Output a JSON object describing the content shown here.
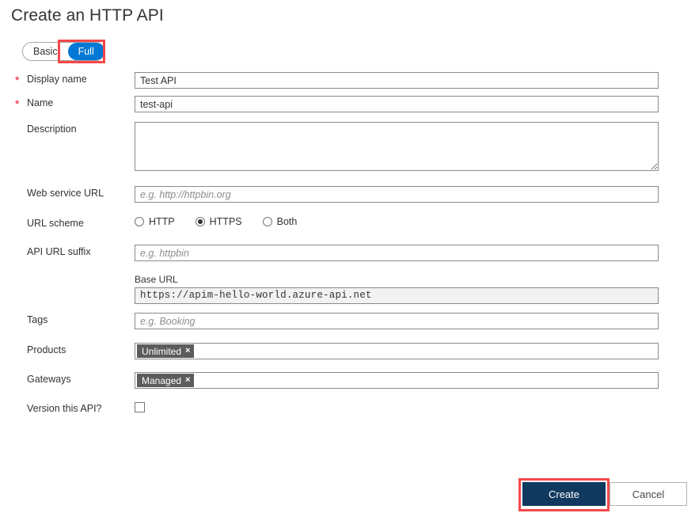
{
  "page": {
    "title": "Create an HTTP API"
  },
  "mode_toggle": {
    "options": [
      {
        "label": "Basic",
        "selected": false
      },
      {
        "label": "Full",
        "selected": true
      }
    ],
    "selected": "Full",
    "accent_color": "#0078d4"
  },
  "annotations": {
    "color": "#f5474a",
    "boxes": [
      "full-toggle",
      "create-button"
    ]
  },
  "form": {
    "required_marker": "*",
    "fields": {
      "display_name": {
        "label": "Display name",
        "required": true,
        "value": "Test API",
        "placeholder": ""
      },
      "name": {
        "label": "Name",
        "required": true,
        "value": "test-api",
        "placeholder": ""
      },
      "description": {
        "label": "Description",
        "required": false,
        "value": "",
        "placeholder": ""
      },
      "web_service_url": {
        "label": "Web service URL",
        "required": false,
        "value": "",
        "placeholder": "e.g. http://httpbin.org"
      },
      "url_scheme": {
        "label": "URL scheme",
        "options": [
          {
            "label": "HTTP",
            "checked": false
          },
          {
            "label": "HTTPS",
            "checked": true
          },
          {
            "label": "Both",
            "checked": false
          }
        ],
        "selected": "HTTPS"
      },
      "api_url_suffix": {
        "label": "API URL suffix",
        "required": false,
        "value": "",
        "placeholder": "e.g. httpbin"
      },
      "base_url": {
        "label": "Base URL",
        "value": "https://apim-hello-world.azure-api.net",
        "readonly": true
      },
      "tags": {
        "label": "Tags",
        "required": false,
        "value": "",
        "placeholder": "e.g. Booking"
      },
      "products": {
        "label": "Products",
        "chips": [
          {
            "label": "Unlimited",
            "remove": "×"
          }
        ]
      },
      "gateways": {
        "label": "Gateways",
        "chips": [
          {
            "label": "Managed",
            "remove": "×"
          }
        ]
      },
      "version_this_api": {
        "label": "Version this API?",
        "checked": false
      }
    }
  },
  "footer": {
    "create_label": "Create",
    "cancel_label": "Cancel",
    "create_color": "#11395f"
  }
}
